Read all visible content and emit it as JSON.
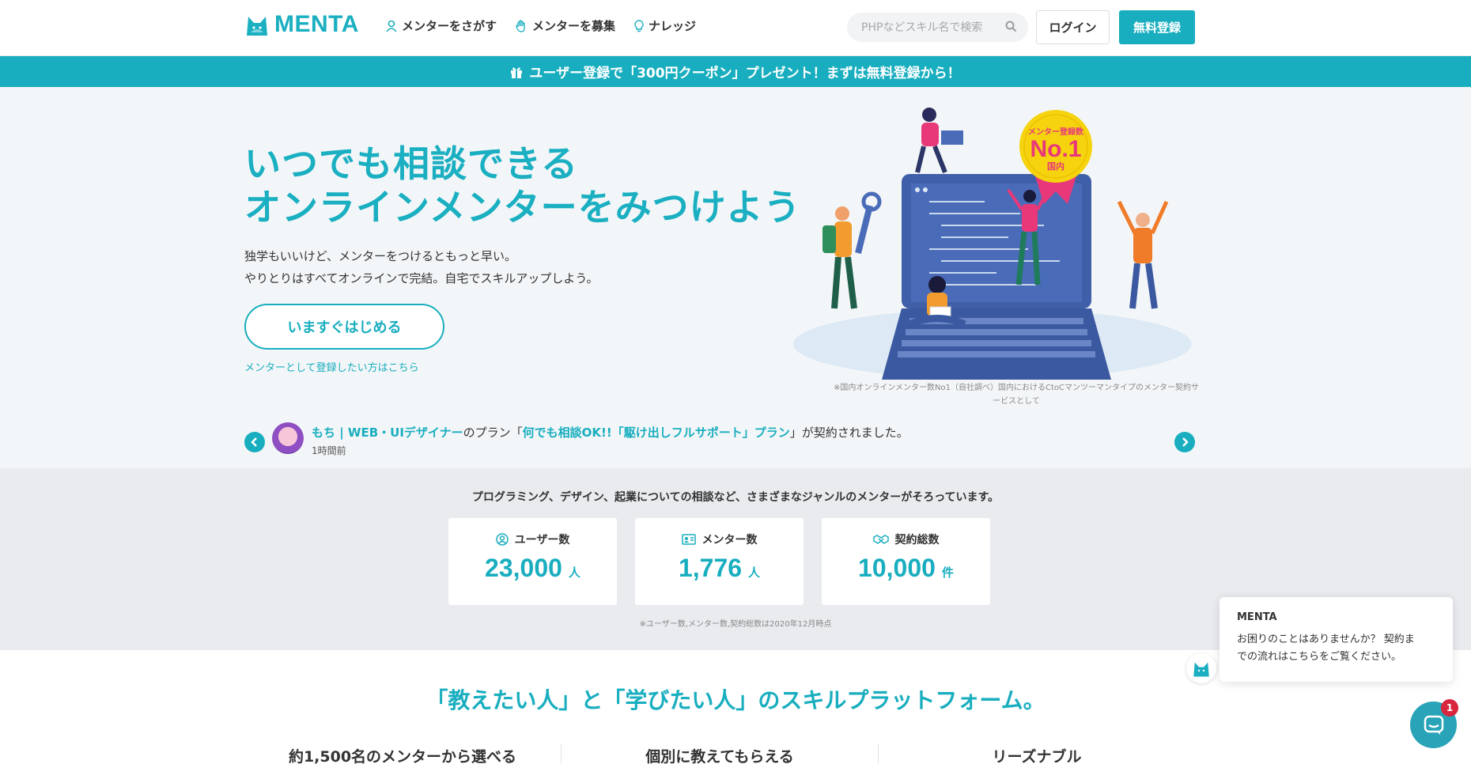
{
  "header": {
    "logo_text": "MENTA",
    "nav": [
      {
        "label": "メンターをさがす",
        "icon": "person-icon"
      },
      {
        "label": "メンターを募集",
        "icon": "hand-icon"
      },
      {
        "label": "ナレッジ",
        "icon": "lightbulb-icon"
      }
    ],
    "search_placeholder": "PHPなどスキル名で検索",
    "login_label": "ログイン",
    "register_label": "無料登録"
  },
  "banner": {
    "text": "ユーザー登録で「300円クーポン」プレゼント！まずは無料登録から！",
    "icon": "gift-icon"
  },
  "hero": {
    "title_line1": "いつでも相談できる",
    "title_line2": "オンラインメンターをみつけよう",
    "sub_line1": "独学もいいけど、メンターをつけるともっと早い。",
    "sub_line2": "やりとりはすべてオンラインで完結。自宅でスキルアップしよう。",
    "cta_label": "いますぐはじめる",
    "mentor_link": "メンターとして登録したい方はこちら",
    "badge_top": "メンター登録数",
    "badge_main": "No.1",
    "badge_bottom": "国内",
    "note": "※国内オンラインメンター数No1（自社調べ）国内におけるCtoCマンツーマンタイプのメンター契約サービスとして"
  },
  "ticker": {
    "user": "もち | WEB・UIデザイナー",
    "mid1": "のプラン「",
    "plan": "何でも相談OK!!「駆け出しフルサポート」プラン",
    "mid2": "」が契約されました。",
    "time": "1時間前"
  },
  "stats": {
    "lead": "プログラミング、デザイン、起業についての相談など、さまざまなジャンルのメンターがそろっています。",
    "cards": [
      {
        "label": "ユーザー数",
        "value": "23,000",
        "unit": "人",
        "icon": "user-circle-icon"
      },
      {
        "label": "メンター数",
        "value": "1,776",
        "unit": "人",
        "icon": "id-card-icon"
      },
      {
        "label": "契約総数",
        "value": "10,000",
        "unit": "件",
        "icon": "handshake-icon"
      }
    ],
    "note": "※ユーザー数,メンター数,契約総数は2020年12月時点"
  },
  "platform": {
    "title": "「教えたい人」と「学びたい人」のスキルプラットフォーム。",
    "features": [
      "約1,500名のメンターから選べる",
      "個別に教えてもらえる",
      "リーズナブル"
    ]
  },
  "chat": {
    "name": "MENTA",
    "message_line1": "お困りのことはありませんか？ 契約ま",
    "message_line2": "での流れはこちらをご覧ください。",
    "badge": "1"
  },
  "colors": {
    "accent": "#19aebf",
    "hero_bg": "#f3f6f8",
    "stats_bg": "#e9ebef",
    "badge_gold": "#f5d30f",
    "ribbon": "#e8387a"
  }
}
